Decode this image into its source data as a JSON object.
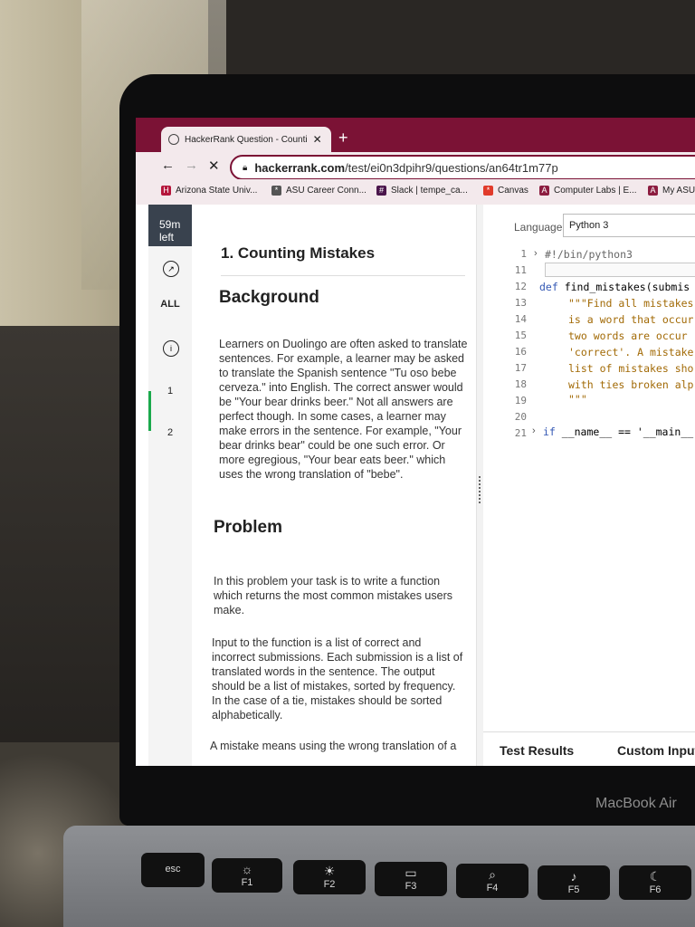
{
  "browser": {
    "tab_title": "HackerRank Question - Counti",
    "url_host": "hackerrank.com",
    "url_path": "/test/ei0n3dpihr9/questions/an64tr1m77p",
    "bookmarks": [
      {
        "label": "Arizona State Univ...",
        "color": "#b5173c",
        "icon": "H"
      },
      {
        "label": "ASU Career Conn...",
        "color": "#555555",
        "icon": "*"
      },
      {
        "label": "Slack | tempe_ca...",
        "color": "#4a154b",
        "icon": "#"
      },
      {
        "label": "Canvas",
        "color": "#e13b2b",
        "icon": "*"
      },
      {
        "label": "Computer Labs | E...",
        "color": "#8c1d40",
        "icon": "A"
      },
      {
        "label": "My ASU",
        "color": "#8c1d40",
        "icon": "A"
      }
    ]
  },
  "sidebar": {
    "timer": "59m left",
    "items": [
      "ALL",
      "1",
      "2"
    ]
  },
  "question": {
    "title": "1. Counting Mistakes",
    "background_heading": "Background",
    "background_text": "Learners on Duolingo are often asked to translate sentences. For example, a learner may be asked to translate the Spanish sentence \"Tu oso bebe cerveza.\" into English. The correct answer would be \"Your bear drinks beer.\" Not all answers are perfect though. In some cases, a learner may make errors in the sentence. For example, \"Your bear drinks bear\" could be one such error. Or more egregious, \"Your bear eats beer.\" which uses the wrong translation of \"bebe\".",
    "problem_heading": "Problem",
    "problem_text_1": "In this problem your task is to write a function which returns the most common mistakes users make.",
    "problem_text_2": "Input to the function is a list of correct and incorrect submissions. Each submission is a list of translated words in the sentence. The output should be a list of mistakes, sorted by frequency. In the case of a tie, mistakes should be sorted alphabetically.",
    "problem_text_3": "A mistake means using the wrong translation of a"
  },
  "editor": {
    "language_label": "Language",
    "language_value": "Python 3",
    "line_numbers": [
      "1",
      "11",
      "12",
      "13",
      "14",
      "15",
      "16",
      "17",
      "18",
      "19",
      "20",
      "21"
    ],
    "line1": "#!/bin/python3",
    "line12_kw": "def",
    "line12_rest": " find_mistakes(submis",
    "line13": "\"\"\"Find all mistakes",
    "line14": "is a word that occur",
    "line15": "two words are occur",
    "line16": "'correct'. A mistake",
    "line17": "list of mistakes sho",
    "line18": "with ties broken alp",
    "line19": "\"\"\"",
    "line21_kw": "if",
    "line21_rest": " __name__ == '__main__",
    "bottom_tabs": [
      "Test Results",
      "Custom Input"
    ]
  },
  "device": {
    "brand": "MacBook Air",
    "keys": [
      "esc",
      "F1",
      "F2",
      "F3",
      "F4",
      "F5",
      "F6"
    ]
  }
}
